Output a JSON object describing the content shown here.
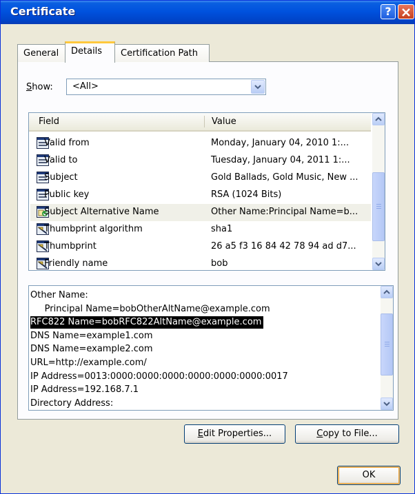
{
  "window": {
    "title": "Certificate"
  },
  "tabs": [
    "General",
    "Details",
    "Certification Path"
  ],
  "show": {
    "label_mnemonic": "S",
    "label_rest": "how:",
    "selected": "<All>"
  },
  "fields_table": {
    "headers": [
      "Field",
      "Value"
    ],
    "rows": [
      {
        "icon": "certificate-field-icon",
        "field": "Valid from",
        "value": "Monday, January 04, 2010 1:..."
      },
      {
        "icon": "certificate-field-icon",
        "field": "Valid to",
        "value": "Tuesday, January 04, 2011 1:..."
      },
      {
        "icon": "certificate-field-icon",
        "field": "Subject",
        "value": "Gold Ballads, Gold Music, New ..."
      },
      {
        "icon": "certificate-field-icon",
        "field": "Public key",
        "value": "RSA (1024 Bits)"
      },
      {
        "icon": "certificate-extension-icon",
        "field": "Subject Alternative Name",
        "value": "Other Name:Principal Name=b...",
        "selected": true
      },
      {
        "icon": "certificate-property-icon",
        "field": "Thumbprint algorithm",
        "value": "sha1"
      },
      {
        "icon": "certificate-property-icon",
        "field": "Thumbprint",
        "value": "26 a5 f3 16 84 42 78 94 ad d7..."
      },
      {
        "icon": "certificate-property-icon",
        "field": "Friendly name",
        "value": "bob"
      }
    ]
  },
  "detail_text": [
    "Other Name:",
    "     Principal Name=bobOtherAltName@example.com",
    "RFC822 Name=bobRFC822AltName@example.com",
    "DNS Name=example1.com",
    "DNS Name=example2.com",
    "URL=http://example.com/",
    "IP Address=0013:0000:0000:0000:0000:0000:0000:0017",
    "IP Address=192.168.7.1",
    "Directory Address:"
  ],
  "buttons": {
    "edit_properties": {
      "mnemonic": "E",
      "rest": "dit Properties..."
    },
    "copy_to_file": {
      "mnemonic": "C",
      "rest": "opy to File..."
    },
    "ok": "OK"
  },
  "colors": {
    "titlebar": "#0052de",
    "window_bg": "#ece9d8",
    "active_tab_accent": "#ffc83c",
    "highlight_bg": "#000000",
    "highlight_fg": "#ffffff"
  }
}
